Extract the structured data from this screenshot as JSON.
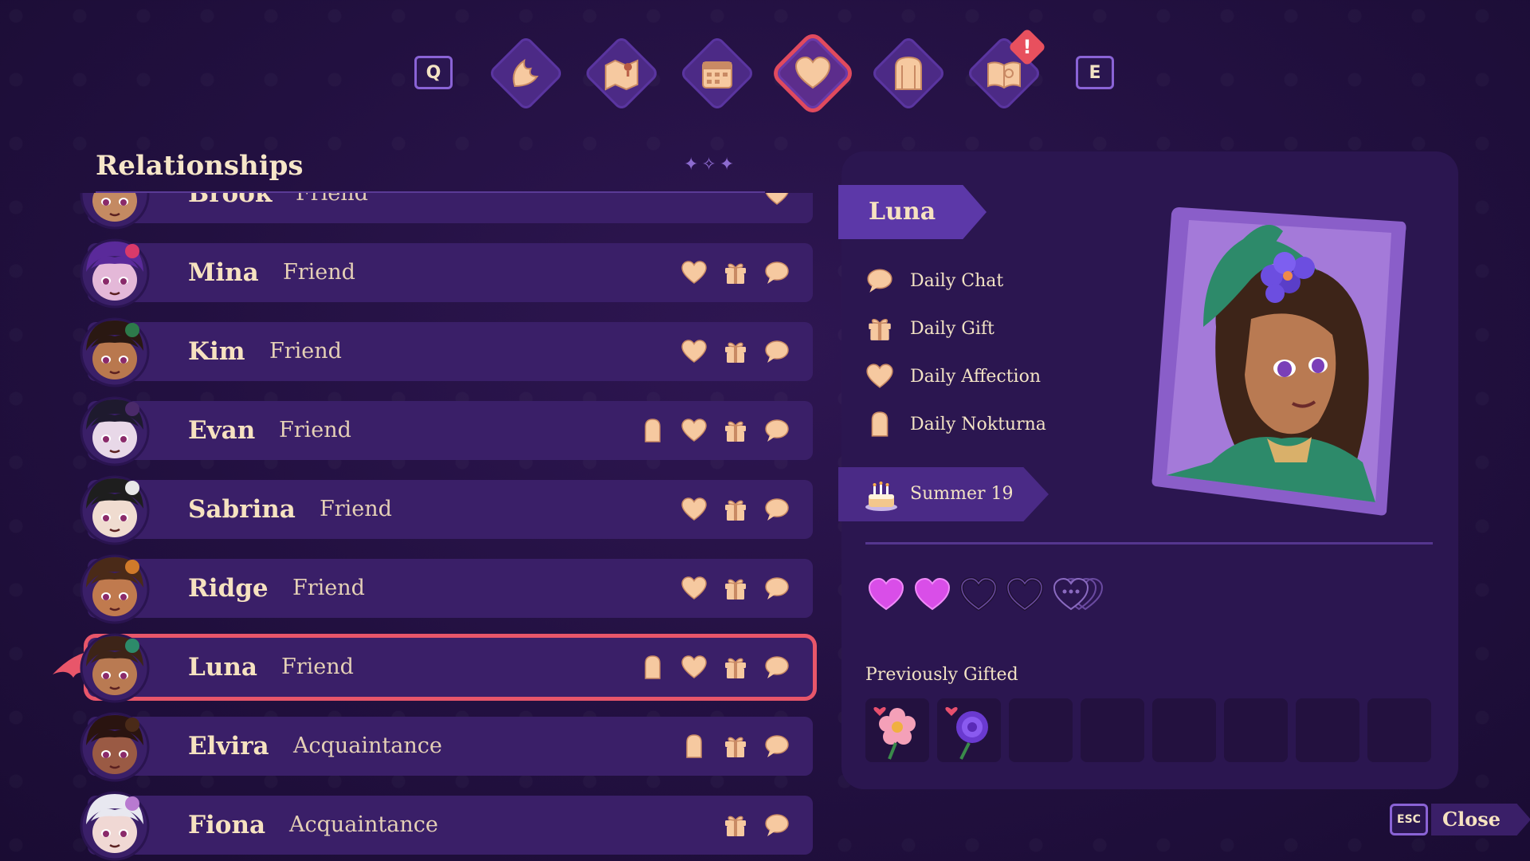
{
  "nav": {
    "prev_key": "Q",
    "next_key": "E",
    "tabs": [
      {
        "icon": "wing-icon",
        "active": false
      },
      {
        "icon": "map-icon",
        "active": false
      },
      {
        "icon": "calendar-icon",
        "active": false
      },
      {
        "icon": "heart-icon",
        "active": true
      },
      {
        "icon": "door-icon",
        "active": false
      },
      {
        "icon": "book-icon",
        "active": false,
        "alert": "!"
      }
    ]
  },
  "relationships": {
    "title": "Relationships",
    "rows": [
      {
        "name": "Brook",
        "status": "Friend",
        "icons": [
          "heart"
        ]
      },
      {
        "name": "Mina",
        "status": "Friend",
        "icons": [
          "heart",
          "gift",
          "chat"
        ]
      },
      {
        "name": "Kim",
        "status": "Friend",
        "icons": [
          "heart",
          "gift",
          "chat"
        ]
      },
      {
        "name": "Evan",
        "status": "Friend",
        "icons": [
          "nokturna",
          "heart",
          "gift",
          "chat"
        ]
      },
      {
        "name": "Sabrina",
        "status": "Friend",
        "icons": [
          "heart",
          "gift",
          "chat"
        ]
      },
      {
        "name": "Ridge",
        "status": "Friend",
        "icons": [
          "heart",
          "gift",
          "chat"
        ]
      },
      {
        "name": "Luna",
        "status": "Friend",
        "icons": [
          "nokturna",
          "heart",
          "gift",
          "chat"
        ],
        "selected": true
      },
      {
        "name": "Elvira",
        "status": "Acquaintance",
        "icons": [
          "nokturna",
          "gift",
          "chat"
        ]
      },
      {
        "name": "Fiona",
        "status": "Acquaintance",
        "icons": [
          "gift",
          "chat"
        ]
      }
    ]
  },
  "detail": {
    "name": "Luna",
    "dailies": [
      {
        "icon": "chat-icon",
        "label": "Daily Chat"
      },
      {
        "icon": "gift-icon",
        "label": "Daily Gift"
      },
      {
        "icon": "heart-icon",
        "label": "Daily Affection"
      },
      {
        "icon": "nokturna-icon",
        "label": "Daily Nokturna"
      }
    ],
    "birthday": "Summer 19",
    "hearts_filled": 2,
    "hearts_total": 4,
    "previously_gifted_label": "Previously Gifted",
    "gifts": [
      "pink-flower-icon",
      "purple-rose-icon",
      "",
      "",
      "",
      "",
      "",
      ""
    ]
  },
  "colors": {
    "accent_gold": "#f6c9a0",
    "heart_filled": "#d94ee8",
    "selection": "#e8566a",
    "panel": "#2b1650"
  },
  "close": {
    "key": "ESC",
    "label": "Close"
  }
}
